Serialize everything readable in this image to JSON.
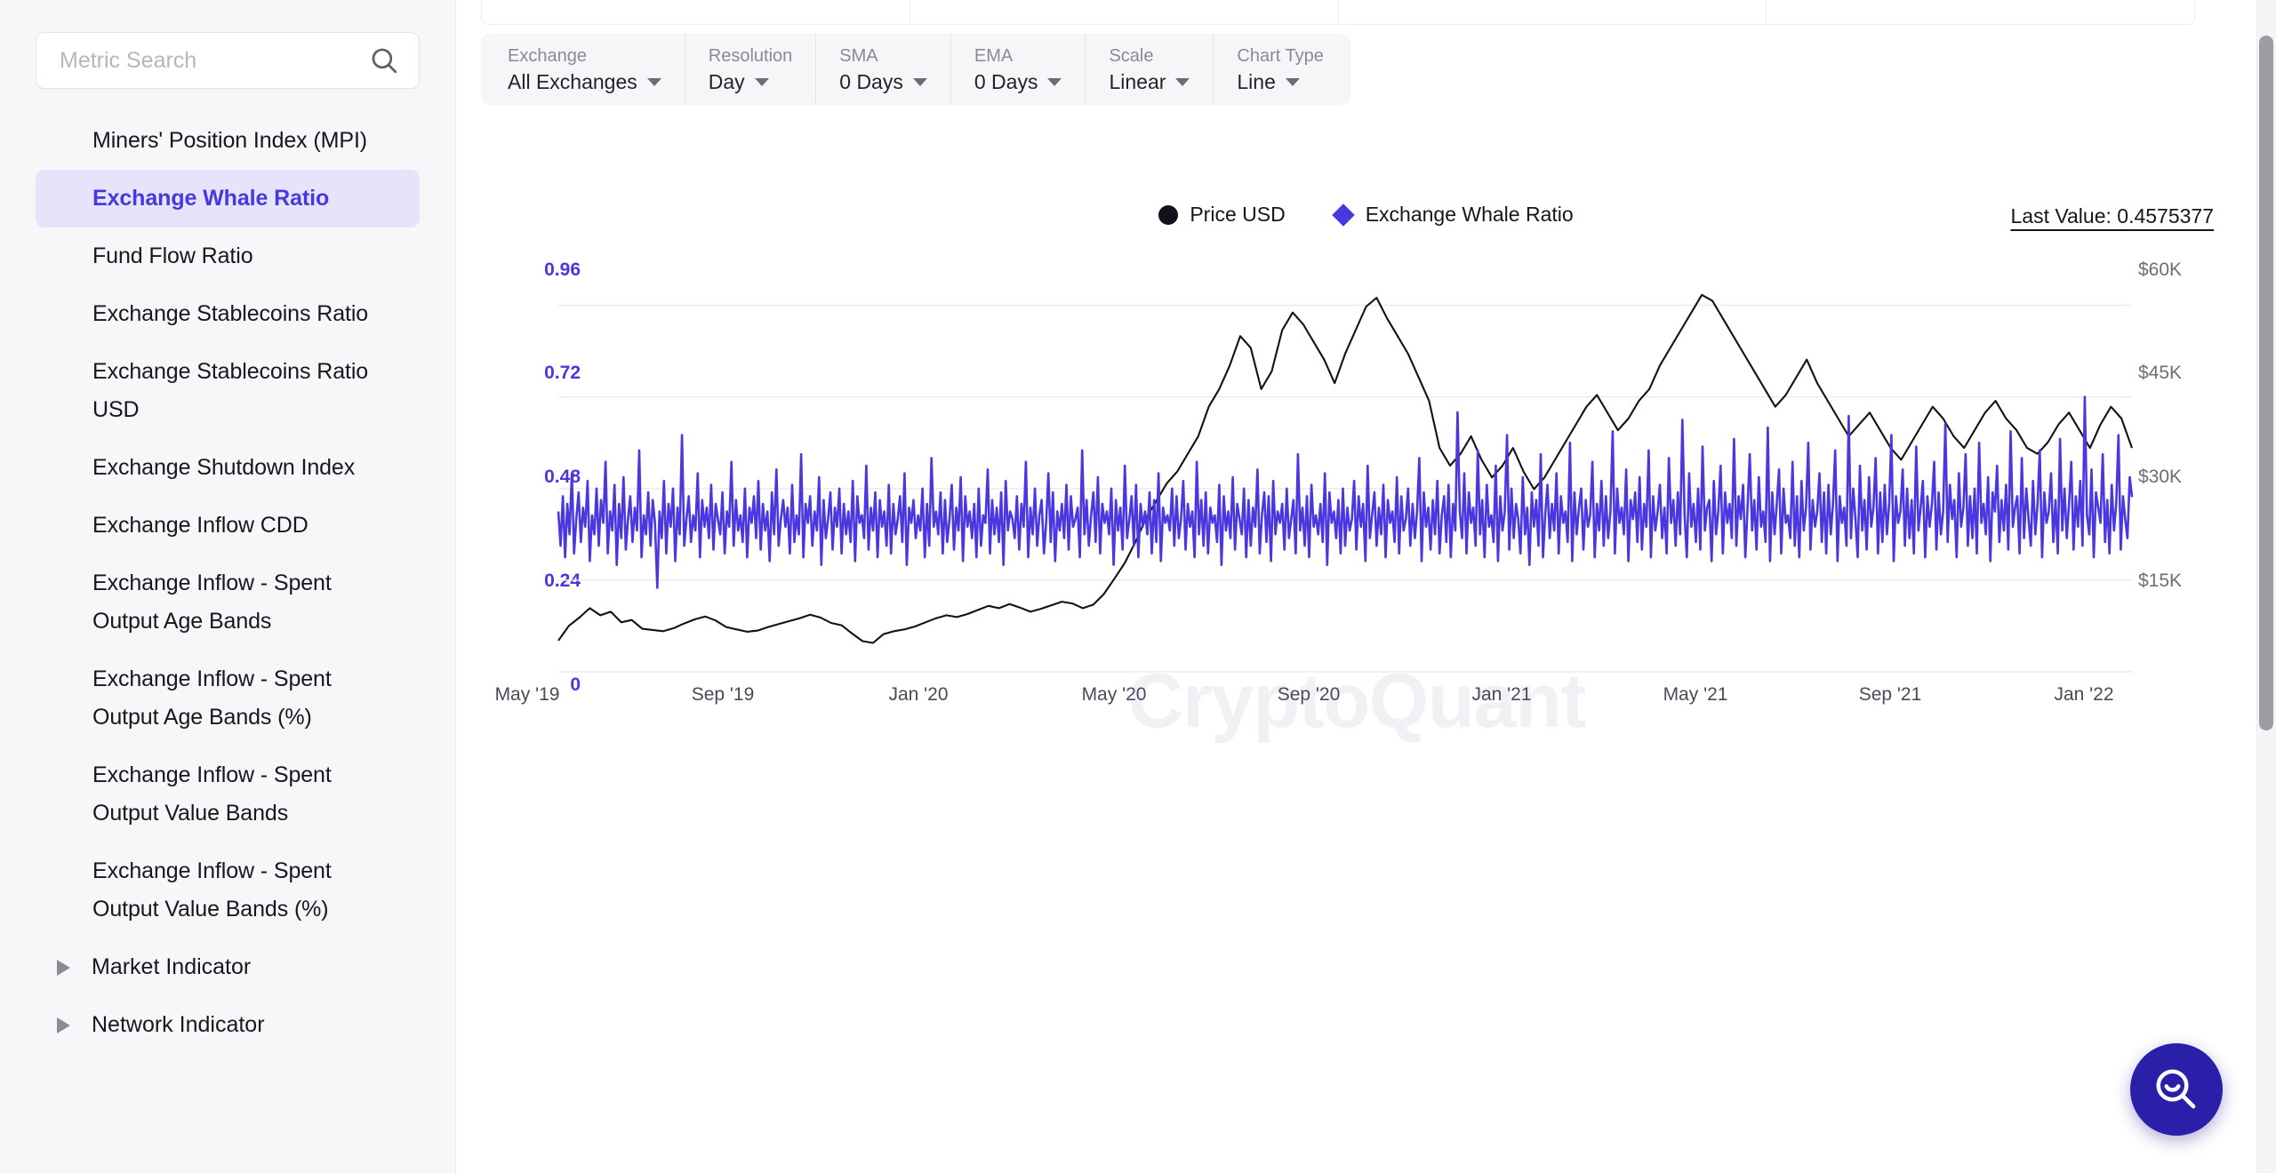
{
  "sidebar": {
    "search": {
      "placeholder": "Metric Search",
      "value": "",
      "icon": "search-icon"
    },
    "items": [
      {
        "label": "Miners' Position Index (MPI)",
        "active": false
      },
      {
        "label": "Exchange Whale Ratio",
        "active": true
      },
      {
        "label": "Fund Flow Ratio",
        "active": false
      },
      {
        "label": "Exchange Stablecoins Ratio",
        "active": false
      },
      {
        "label": "Exchange Stablecoins Ratio USD",
        "active": false
      },
      {
        "label": "Exchange Shutdown Index",
        "active": false
      },
      {
        "label": "Exchange Inflow CDD",
        "active": false
      },
      {
        "label": "Exchange Inflow - Spent Output Age Bands",
        "active": false
      },
      {
        "label": "Exchange Inflow - Spent Output Age Bands (%)",
        "active": false
      },
      {
        "label": "Exchange Inflow - Spent Output Value Bands",
        "active": false
      },
      {
        "label": "Exchange Inflow - Spent Output Value Bands (%)",
        "active": false
      }
    ],
    "groups": [
      {
        "label": "Market Indicator",
        "expanded": false,
        "icon": "caret-right-icon"
      },
      {
        "label": "Network Indicator",
        "expanded": false,
        "icon": "caret-right-icon"
      }
    ]
  },
  "toolbar": {
    "controls": [
      {
        "label": "Exchange",
        "value": "All Exchanges"
      },
      {
        "label": "Resolution",
        "value": "Day"
      },
      {
        "label": "SMA",
        "value": "0 Days"
      },
      {
        "label": "EMA",
        "value": "0 Days"
      },
      {
        "label": "Scale",
        "value": "Linear"
      },
      {
        "label": "Chart Type",
        "value": "Line"
      }
    ]
  },
  "chart_header": {
    "legend": [
      {
        "label": "Price USD",
        "marker": "circle",
        "color": "#111118"
      },
      {
        "label": "Exchange Whale Ratio",
        "marker": "diamond",
        "color": "#4b37e0"
      }
    ],
    "last_value": "Last Value: 0.4575377"
  },
  "watermark": "CryptoQuant",
  "help_button": {
    "icon": "search-smile-icon",
    "color": "#2a1fa8"
  },
  "chart_data": {
    "type": "line",
    "title": "Exchange Whale Ratio",
    "watermark": "CryptoQuant",
    "xlabel": "",
    "grid": true,
    "legend_position": "top-center",
    "x_tick_labels": [
      "May '19",
      "Sep '19",
      "Jan '20",
      "May '20",
      "Sep '20",
      "Jan '21",
      "May '21",
      "Sep '21",
      "Jan '22"
    ],
    "left_axis": {
      "name": "Exchange Whale Ratio",
      "color": "#4b37e0",
      "ticks": [
        0,
        0.24,
        0.48,
        0.72,
        0.96
      ],
      "tick_labels": [
        "0",
        "0.24",
        "0.48",
        "0.72",
        "0.96"
      ],
      "ylim": [
        0,
        1.08
      ]
    },
    "right_axis": {
      "name": "Price USD",
      "color": "#6d6d7a",
      "ticks": [
        15000,
        30000,
        45000,
        60000
      ],
      "tick_labels": [
        "$15K",
        "$30K",
        "$45K",
        "$60K"
      ],
      "ylim": [
        0,
        70000
      ]
    },
    "series": [
      {
        "name": "Exchange Whale Ratio",
        "axis": "left",
        "color": "#4b37e0",
        "values": [
          0.42,
          0.33,
          0.46,
          0.3,
          0.44,
          0.36,
          0.52,
          0.31,
          0.4,
          0.47,
          0.34,
          0.43,
          0.38,
          0.5,
          0.29,
          0.41,
          0.36,
          0.48,
          0.33,
          0.45,
          0.39,
          0.55,
          0.31,
          0.42,
          0.37,
          0.49,
          0.28,
          0.44,
          0.35,
          0.51,
          0.32,
          0.4,
          0.46,
          0.34,
          0.43,
          0.37,
          0.58,
          0.3,
          0.41,
          0.36,
          0.47,
          0.33,
          0.45,
          0.39,
          0.22,
          0.42,
          0.35,
          0.5,
          0.31,
          0.44,
          0.38,
          0.48,
          0.29,
          0.43,
          0.36,
          0.62,
          0.33,
          0.4,
          0.46,
          0.34,
          0.41,
          0.37,
          0.52,
          0.3,
          0.45,
          0.38,
          0.43,
          0.35,
          0.49,
          0.32,
          0.44,
          0.4,
          0.36,
          0.47,
          0.31,
          0.42,
          0.38,
          0.55,
          0.33,
          0.45,
          0.37,
          0.41,
          0.34,
          0.48,
          0.3,
          0.43,
          0.39,
          0.46,
          0.35,
          0.5,
          0.32,
          0.44,
          0.37,
          0.42,
          0.29,
          0.47,
          0.36,
          0.53,
          0.33,
          0.4,
          0.45,
          0.38,
          0.43,
          0.31,
          0.49,
          0.34,
          0.41,
          0.36,
          0.57,
          0.3,
          0.44,
          0.39,
          0.46,
          0.33,
          0.42,
          0.37,
          0.51,
          0.28,
          0.45,
          0.35,
          0.4,
          0.47,
          0.32,
          0.43,
          0.38,
          0.48,
          0.31,
          0.44,
          0.36,
          0.42,
          0.34,
          0.5,
          0.29,
          0.46,
          0.39,
          0.41,
          0.35,
          0.54,
          0.32,
          0.43,
          0.37,
          0.47,
          0.3,
          0.45,
          0.38,
          0.42,
          0.33,
          0.49,
          0.31,
          0.44,
          0.36,
          0.4,
          0.46,
          0.34,
          0.52,
          0.28,
          0.43,
          0.39,
          0.45,
          0.35,
          0.41,
          0.37,
          0.48,
          0.3,
          0.44,
          0.33,
          0.56,
          0.38,
          0.42,
          0.36,
          0.47,
          0.31,
          0.45,
          0.34,
          0.4,
          0.49,
          0.32,
          0.43,
          0.37,
          0.51,
          0.29,
          0.46,
          0.38,
          0.42,
          0.35,
          0.44,
          0.3,
          0.48,
          0.33,
          0.41,
          0.39,
          0.53,
          0.31,
          0.45,
          0.36,
          0.43,
          0.34,
          0.47,
          0.28,
          0.5,
          0.37,
          0.42,
          0.4,
          0.35,
          0.46,
          0.32,
          0.44,
          0.38,
          0.55,
          0.3,
          0.43,
          0.36,
          0.48,
          0.33,
          0.41,
          0.45,
          0.31,
          0.39,
          0.52,
          0.34,
          0.47,
          0.29,
          0.42,
          0.37,
          0.44,
          0.35,
          0.49,
          0.32,
          0.46,
          0.38,
          0.4,
          0.43,
          0.3,
          0.58,
          0.36,
          0.45,
          0.33,
          0.41,
          0.47,
          0.34,
          0.51,
          0.31,
          0.44,
          0.39,
          0.42,
          0.36,
          0.48,
          0.28,
          0.45,
          0.37,
          0.43,
          0.32,
          0.54,
          0.35,
          0.4,
          0.46,
          0.33,
          0.49,
          0.3,
          0.44,
          0.38,
          0.42,
          0.36,
          0.47,
          0.31,
          0.45,
          0.34,
          0.52,
          0.29,
          0.43,
          0.39,
          0.41,
          0.37,
          0.48,
          0.33,
          0.46,
          0.35,
          0.4,
          0.5,
          0.32,
          0.44,
          0.38,
          0.42,
          0.3,
          0.55,
          0.36,
          0.45,
          0.33,
          0.47,
          0.31,
          0.43,
          0.39,
          0.41,
          0.34,
          0.49,
          0.28,
          0.46,
          0.37,
          0.42,
          0.35,
          0.51,
          0.32,
          0.44,
          0.4,
          0.36,
          0.48,
          0.3,
          0.45,
          0.33,
          0.43,
          0.38,
          0.53,
          0.31,
          0.41,
          0.47,
          0.34,
          0.46,
          0.29,
          0.5,
          0.36,
          0.42,
          0.39,
          0.44,
          0.32,
          0.48,
          0.35,
          0.4,
          0.45,
          0.31,
          0.57,
          0.37,
          0.43,
          0.33,
          0.46,
          0.3,
          0.49,
          0.38,
          0.41,
          0.36,
          0.44,
          0.34,
          0.52,
          0.28,
          0.47,
          0.39,
          0.42,
          0.35,
          0.45,
          0.31,
          0.48,
          0.33,
          0.43,
          0.37,
          0.4,
          0.5,
          0.32,
          0.46,
          0.38,
          0.44,
          0.29,
          0.54,
          0.35,
          0.41,
          0.47,
          0.33,
          0.43,
          0.36,
          0.49,
          0.3,
          0.45,
          0.39,
          0.42,
          0.34,
          0.51,
          0.31,
          0.46,
          0.37,
          0.4,
          0.48,
          0.33,
          0.44,
          0.35,
          0.42,
          0.56,
          0.29,
          0.47,
          0.38,
          0.43,
          0.32,
          0.45,
          0.36,
          0.5,
          0.31,
          0.41,
          0.46,
          0.34,
          0.49,
          0.3,
          0.44,
          0.37,
          0.68,
          0.42,
          0.35,
          0.52,
          0.31,
          0.47,
          0.39,
          0.43,
          0.33,
          0.58,
          0.36,
          0.45,
          0.3,
          0.49,
          0.38,
          0.41,
          0.34,
          0.54,
          0.29,
          0.46,
          0.37,
          0.42,
          0.62,
          0.32,
          0.48,
          0.35,
          0.44,
          0.4,
          0.31,
          0.51,
          0.36,
          0.43,
          0.28,
          0.47,
          0.38,
          0.45,
          0.33,
          0.57,
          0.3,
          0.41,
          0.49,
          0.35,
          0.44,
          0.37,
          0.52,
          0.31,
          0.46,
          0.39,
          0.42,
          0.34,
          0.6,
          0.29,
          0.47,
          0.36,
          0.43,
          0.48,
          0.32,
          0.45,
          0.38,
          0.41,
          0.55,
          0.3,
          0.44,
          0.37,
          0.5,
          0.33,
          0.46,
          0.35,
          0.42,
          0.63,
          0.31,
          0.48,
          0.39,
          0.43,
          0.36,
          0.53,
          0.29,
          0.45,
          0.4,
          0.47,
          0.34,
          0.51,
          0.32,
          0.44,
          0.38,
          0.58,
          0.3,
          0.46,
          0.37,
          0.42,
          0.49,
          0.35,
          0.43,
          0.31,
          0.56,
          0.39,
          0.45,
          0.33,
          0.47,
          0.36,
          0.66,
          0.41,
          0.3,
          0.52,
          0.38,
          0.44,
          0.34,
          0.48,
          0.32,
          0.59,
          0.37,
          0.43,
          0.45,
          0.29,
          0.5,
          0.36,
          0.42,
          0.54,
          0.31,
          0.47,
          0.39,
          0.44,
          0.35,
          0.61,
          0.33,
          0.46,
          0.4,
          0.49,
          0.3,
          0.43,
          0.57,
          0.37,
          0.45,
          0.32,
          0.51,
          0.38,
          0.42,
          0.34,
          0.64,
          0.29,
          0.47,
          0.36,
          0.44,
          0.53,
          0.31,
          0.48,
          0.39,
          0.41,
          0.35,
          0.55,
          0.33,
          0.46,
          0.3,
          0.5,
          0.37,
          0.43,
          0.6,
          0.32,
          0.45,
          0.38,
          0.42,
          0.52,
          0.34,
          0.47,
          0.31,
          0.49,
          0.36,
          0.44,
          0.58,
          0.29,
          0.46,
          0.39,
          0.43,
          0.33,
          0.67,
          0.35,
          0.48,
          0.4,
          0.3,
          0.54,
          0.37,
          0.45,
          0.32,
          0.51,
          0.38,
          0.43,
          0.56,
          0.31,
          0.47,
          0.34,
          0.49,
          0.36,
          0.44,
          0.62,
          0.29,
          0.46,
          0.39,
          0.42,
          0.53,
          0.33,
          0.48,
          0.35,
          0.45,
          0.31,
          0.59,
          0.37,
          0.43,
          0.5,
          0.3,
          0.46,
          0.38,
          0.44,
          0.55,
          0.32,
          0.47,
          0.36,
          0.42,
          0.65,
          0.34,
          0.49,
          0.4,
          0.45,
          0.3,
          0.52,
          0.38,
          0.43,
          0.57,
          0.33,
          0.46,
          0.35,
          0.48,
          0.31,
          0.6,
          0.39,
          0.44,
          0.36,
          0.51,
          0.29,
          0.47,
          0.42,
          0.54,
          0.34,
          0.45,
          0.37,
          0.49,
          0.32,
          0.63,
          0.38,
          0.43,
          0.46,
          0.31,
          0.56,
          0.35,
          0.48,
          0.4,
          0.33,
          0.5,
          0.36,
          0.44,
          0.58,
          0.3,
          0.47,
          0.39,
          0.42,
          0.52,
          0.34,
          0.45,
          0.31,
          0.61,
          0.37,
          0.48,
          0.35,
          0.44,
          0.55,
          0.32,
          0.46,
          0.38,
          0.5,
          0.33,
          0.72,
          0.41,
          0.36,
          0.53,
          0.3,
          0.47,
          0.43,
          0.39,
          0.57,
          0.34,
          0.45,
          0.31,
          0.49,
          0.37,
          0.44,
          0.62,
          0.32,
          0.46,
          0.4,
          0.35,
          0.51,
          0.4575377
        ]
      },
      {
        "name": "Price USD",
        "axis": "right",
        "color": "#111118",
        "values": [
          5300,
          7800,
          9200,
          10800,
          9600,
          10200,
          8400,
          8800,
          7300,
          7100,
          6900,
          7400,
          8200,
          8900,
          9400,
          8700,
          7600,
          7200,
          6800,
          7000,
          7600,
          8100,
          8600,
          9100,
          9700,
          9200,
          8300,
          7900,
          6500,
          5200,
          4900,
          6400,
          6900,
          7200,
          7700,
          8400,
          9100,
          9600,
          9300,
          9800,
          10500,
          11200,
          10800,
          11500,
          10900,
          10200,
          10700,
          11300,
          11900,
          11600,
          10800,
          11400,
          13200,
          15800,
          18500,
          22000,
          26000,
          29000,
          32000,
          34000,
          37000,
          40000,
          45000,
          48000,
          52000,
          57000,
          55000,
          48000,
          51000,
          58000,
          61000,
          59000,
          56000,
          53000,
          49000,
          54000,
          58000,
          62000,
          63500,
          60000,
          57000,
          54000,
          50000,
          46000,
          38000,
          35000,
          37000,
          40000,
          36000,
          33000,
          35000,
          38000,
          34000,
          31000,
          33000,
          36000,
          39000,
          42000,
          45000,
          47000,
          44000,
          41000,
          43000,
          46000,
          48000,
          52000,
          55000,
          58000,
          61000,
          64000,
          63000,
          60000,
          57000,
          54000,
          51000,
          48000,
          45000,
          47000,
          50000,
          53000,
          49000,
          46000,
          43000,
          40000,
          42000,
          44000,
          41000,
          38000,
          36000,
          39000,
          42000,
          45000,
          43000,
          40000,
          38000,
          41000,
          44000,
          46000,
          43000,
          41000,
          38000,
          37000,
          39000,
          42000,
          44000,
          41000,
          38000,
          42000,
          45000,
          43000,
          38000
        ]
      }
    ],
    "annotations": [
      {
        "text": "Last Value: 0.4575377",
        "position": "top-right"
      }
    ]
  }
}
